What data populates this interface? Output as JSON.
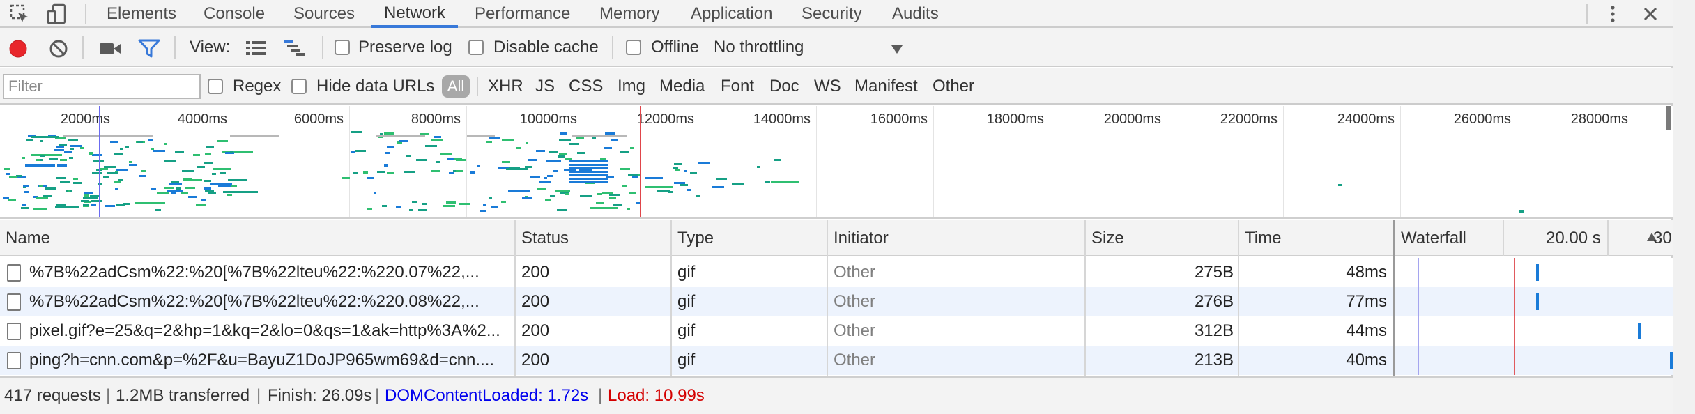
{
  "tabs": [
    "Elements",
    "Console",
    "Sources",
    "Network",
    "Performance",
    "Memory",
    "Application",
    "Security",
    "Audits"
  ],
  "toolbar": {
    "view_label": "View:",
    "preserve_log": "Preserve log",
    "disable_cache": "Disable cache",
    "offline": "Offline",
    "throttling": "No throttling"
  },
  "filterbar": {
    "placeholder": "Filter",
    "regex": "Regex",
    "hide_data_urls": "Hide data URLs",
    "all": "All",
    "types": [
      "XHR",
      "JS",
      "CSS",
      "Img",
      "Media",
      "Font",
      "Doc",
      "WS",
      "Manifest",
      "Other"
    ]
  },
  "overview": {
    "ticks": [
      "2000ms",
      "4000ms",
      "6000ms",
      "8000ms",
      "10000ms",
      "12000ms",
      "14000ms",
      "16000ms",
      "18000ms",
      "20000ms",
      "22000ms",
      "24000ms",
      "26000ms",
      "28000ms"
    ]
  },
  "columns": {
    "name": "Name",
    "status": "Status",
    "type": "Type",
    "initiator": "Initiator",
    "size": "Size",
    "time": "Time",
    "waterfall": "Waterfall",
    "wf_time1": "20.00 s",
    "wf_time2": "30"
  },
  "rows": [
    {
      "name": "%7B%22adCsm%22:%20[%7B%22lteu%22:%220.07%22,...",
      "status": "200",
      "type": "gif",
      "initiator": "Other",
      "size": "275B",
      "time": "48ms"
    },
    {
      "name": "%7B%22adCsm%22:%20[%7B%22lteu%22:%220.08%22,...",
      "status": "200",
      "type": "gif",
      "initiator": "Other",
      "size": "276B",
      "time": "77ms"
    },
    {
      "name": "pixel.gif?e=25&q=2&hp=1&kq=2&lo=0&qs=1&ak=http%3A%2...",
      "status": "200",
      "type": "gif",
      "initiator": "Other",
      "size": "312B",
      "time": "44ms"
    },
    {
      "name": "ping?h=cnn.com&p=%2F&u=BayuZ1DoJP965wm69&d=cnn....",
      "status": "200",
      "type": "gif",
      "initiator": "Other",
      "size": "213B",
      "time": "40ms"
    }
  ],
  "statusbar": {
    "requests": "417 requests",
    "transferred": "1.2MB transferred",
    "finish": "Finish: 26.09s",
    "domcontentloaded": "DOMContentLoaded: 1.72s",
    "load": "Load: 10.99s"
  },
  "colors": {
    "accent": "#3879d9",
    "record": "#e8262b",
    "domcontentloaded": "#0000ee",
    "load": "#d40000",
    "bar_green": "#2fbf71",
    "bar_teal": "#16a085",
    "bar_blue": "#1a7bd8"
  }
}
